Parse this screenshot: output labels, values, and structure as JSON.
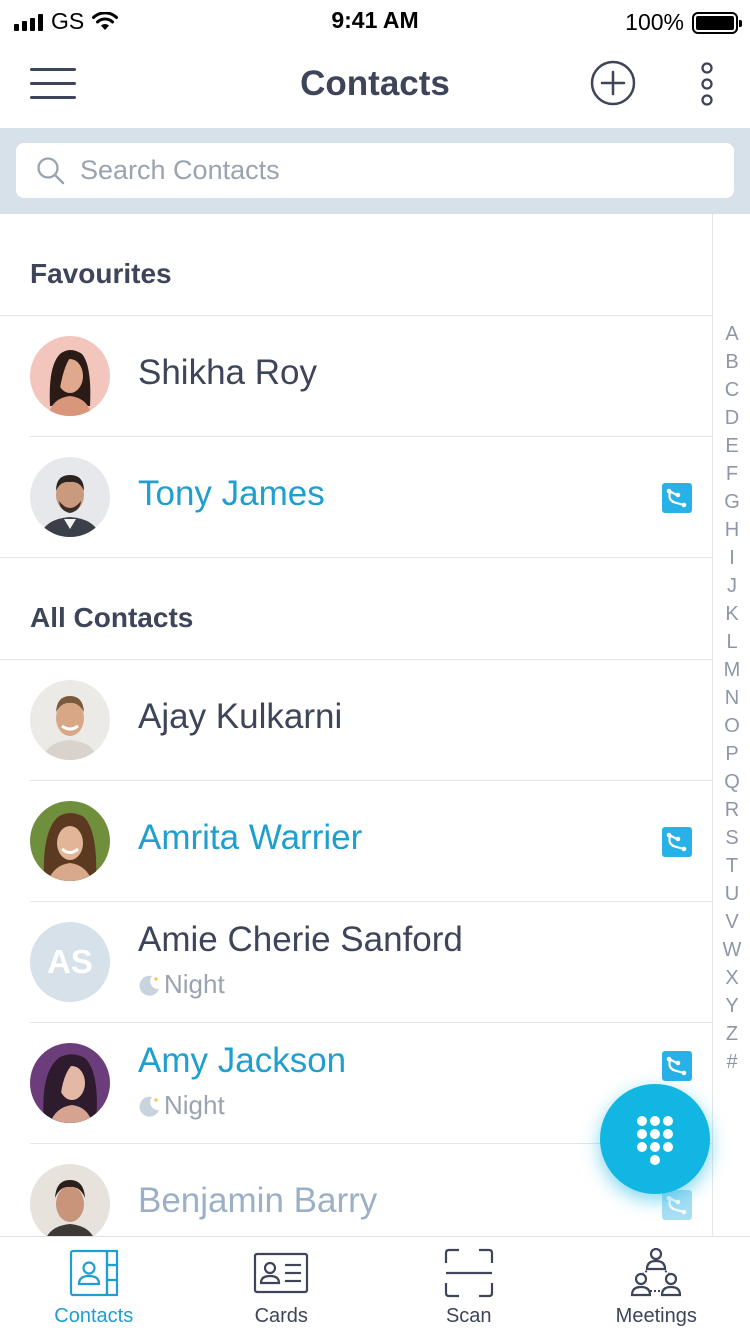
{
  "status_bar": {
    "carrier": "GS",
    "time": "9:41 AM",
    "battery": "100%"
  },
  "header": {
    "title": "Contacts",
    "menu_icon": "hamburger-menu-icon",
    "add_icon": "add-circle-icon",
    "more_icon": "more-vertical-icon"
  },
  "search": {
    "placeholder": "Search Contacts",
    "value": ""
  },
  "sections": {
    "favourites": {
      "title": "Favourites",
      "contacts": [
        {
          "name": "Shikha Roy",
          "app_badge": false
        },
        {
          "name": "Tony James",
          "app_badge": true
        }
      ]
    },
    "all": {
      "title": "All Contacts",
      "contacts": [
        {
          "name": "Ajay Kulkarni",
          "app_badge": false
        },
        {
          "name": "Amrita Warrier",
          "app_badge": true
        },
        {
          "name": "Amie Cherie Sanford",
          "initials": "AS",
          "status": "Night",
          "app_badge": false
        },
        {
          "name": "Amy Jackson",
          "status": "Night",
          "app_badge": true
        },
        {
          "name": "Benjamin Barry",
          "app_badge": true
        }
      ]
    }
  },
  "alphabet_index": [
    "A",
    "B",
    "C",
    "D",
    "E",
    "F",
    "G",
    "H",
    "I",
    "J",
    "K",
    "L",
    "M",
    "N",
    "O",
    "P",
    "Q",
    "R",
    "S",
    "T",
    "U",
    "V",
    "W",
    "X",
    "Y",
    "Z",
    "#"
  ],
  "fab": {
    "icon": "dialpad-icon"
  },
  "tabbar": {
    "tabs": [
      {
        "label": "Contacts",
        "icon": "contacts-book-icon",
        "active": true
      },
      {
        "label": "Cards",
        "icon": "business-card-icon",
        "active": false
      },
      {
        "label": "Scan",
        "icon": "scan-frame-icon",
        "active": false
      },
      {
        "label": "Meetings",
        "icon": "meetings-group-icon",
        "active": false
      }
    ]
  },
  "colors": {
    "accent": "#1e9fd0",
    "fab": "#12b6e2",
    "text": "#3e4459",
    "search_bg": "#d7e1ea",
    "muted": "#9aa3b0"
  }
}
